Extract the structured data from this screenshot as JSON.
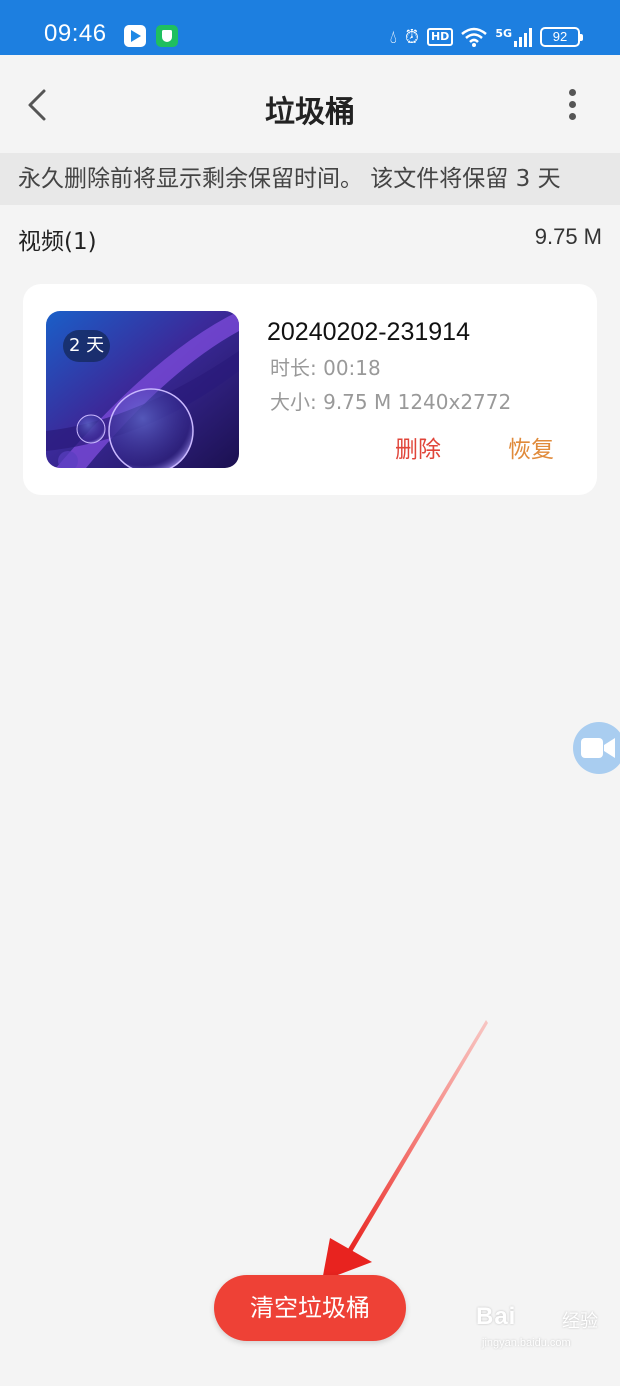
{
  "status_bar": {
    "time": "09:46",
    "network_type": "5G",
    "hd_label": "HD",
    "battery": "92"
  },
  "header": {
    "title": "垃圾桶"
  },
  "notice": "永久删除前将显示剩余保留时间。 该文件将保留 3 天",
  "section": {
    "title": "视频(1)",
    "size": "9.75 M"
  },
  "items": [
    {
      "days_left": "2 天",
      "name": "20240202-231914",
      "duration": "时长: 00:18",
      "size_info": "大小: 9.75 M 1240x2772",
      "delete_label": "删除",
      "restore_label": "恢复"
    }
  ],
  "footer": {
    "empty_label": "清空垃圾桶"
  },
  "watermark": {
    "brand": "Bai",
    "brand_cn": "经验",
    "url": "jingyan.baidu.com"
  },
  "icons": {
    "back": "back-arrow-icon",
    "more": "more-vertical-icon",
    "record": "video-camera-icon"
  },
  "colors": {
    "status_bar": "#1d7fe0",
    "delete": "#e0453a",
    "restore": "#e08a3a",
    "empty_button": "#ee4136",
    "arrow": "#e8231f"
  }
}
